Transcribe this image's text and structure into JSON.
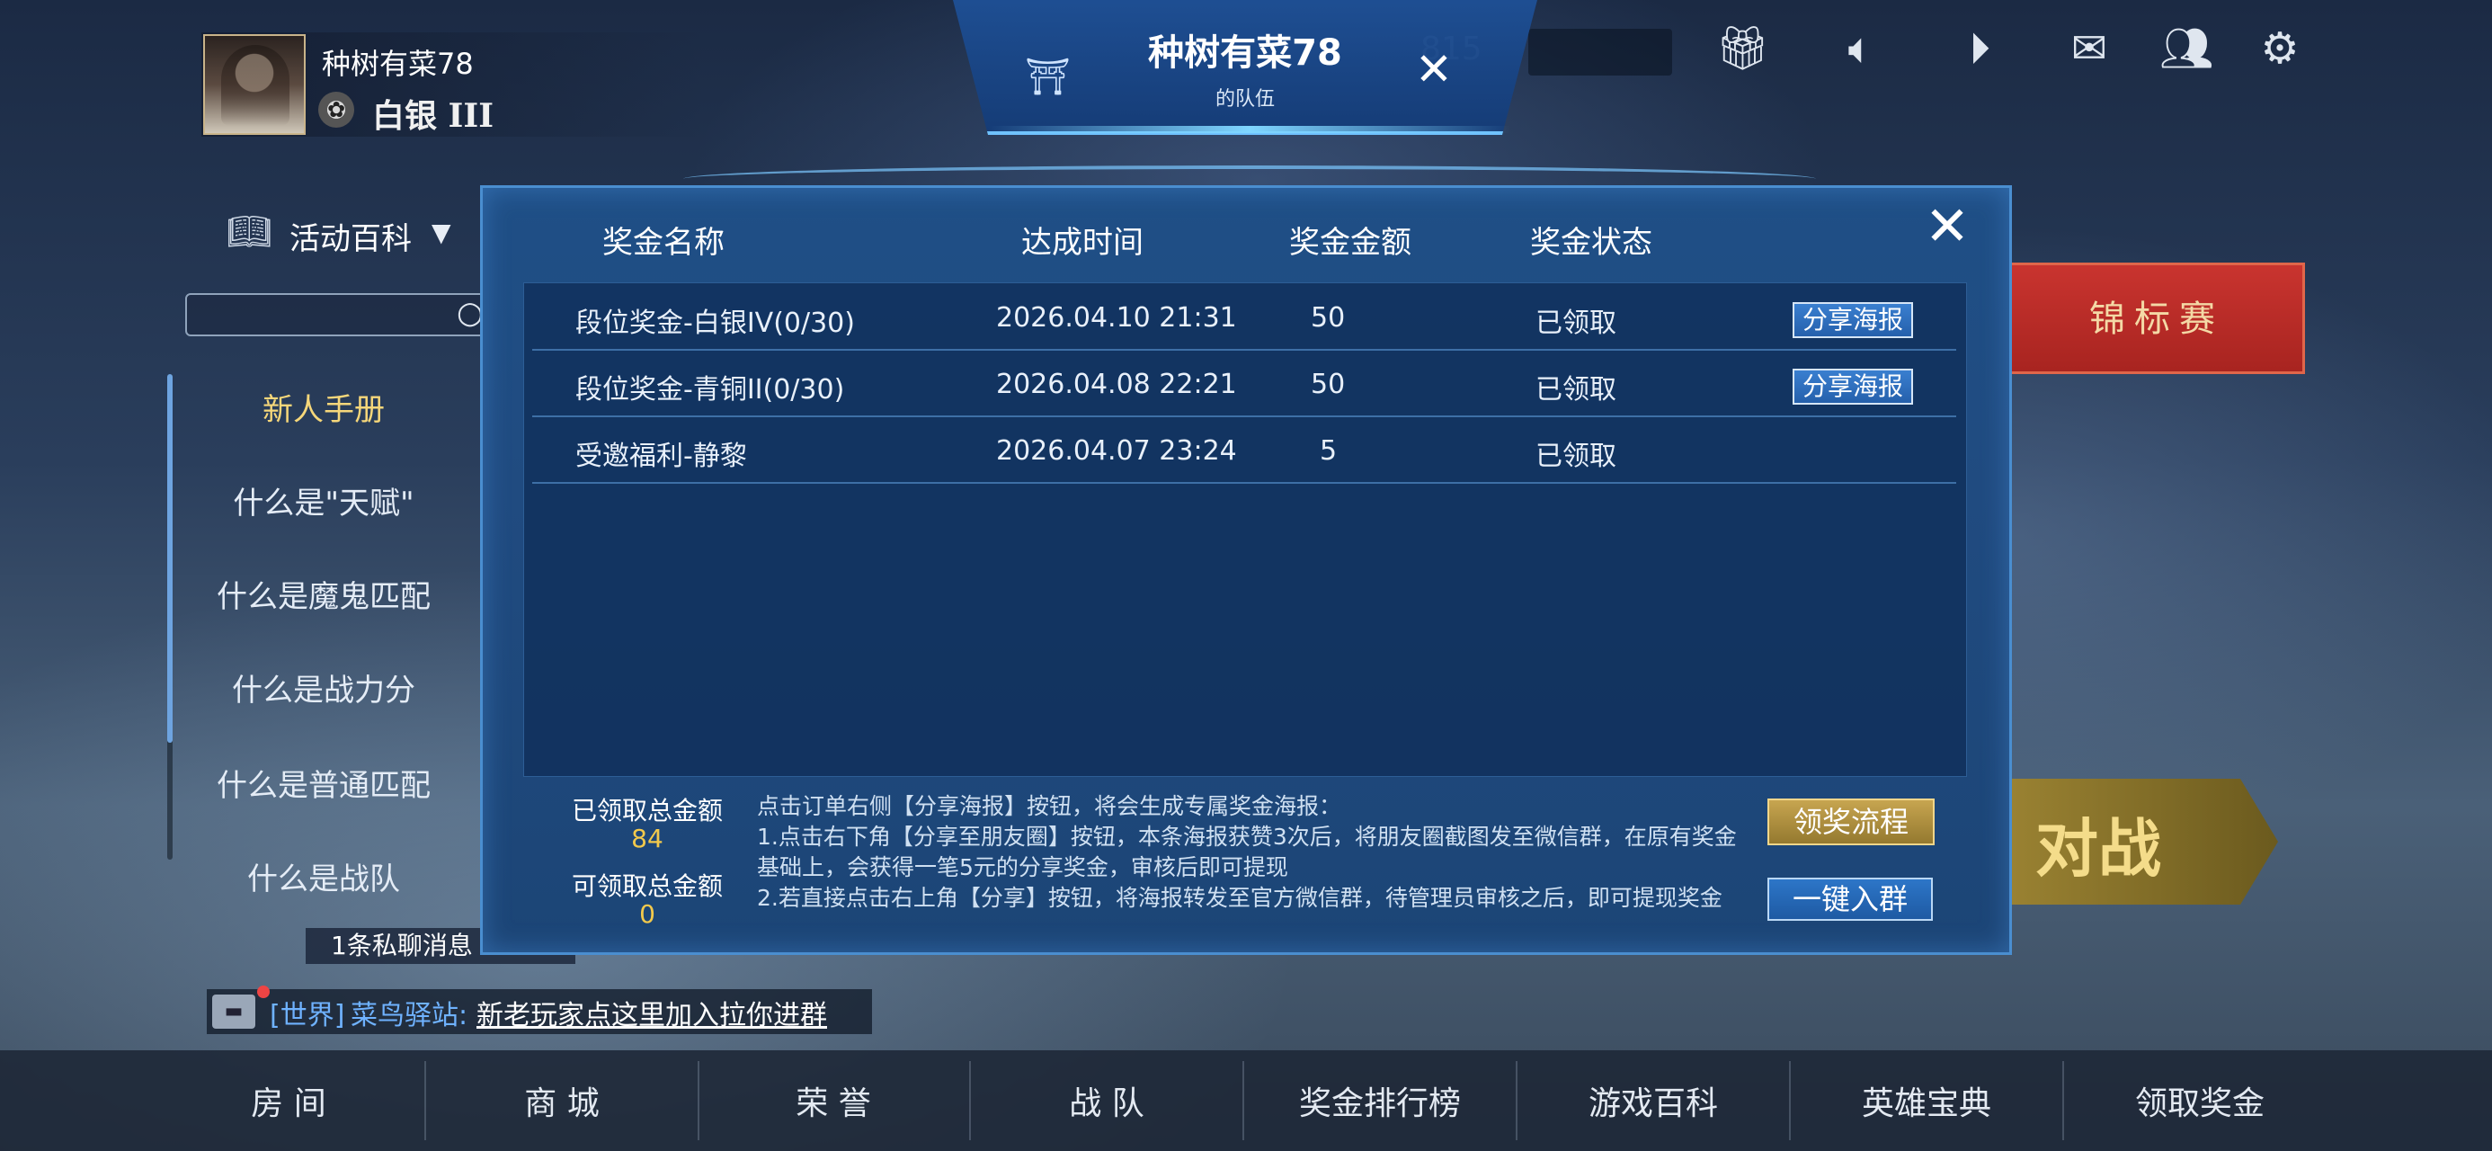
{
  "profile": {
    "username": "种树有菜78",
    "rank": "白银 III"
  },
  "team": {
    "name": "种树有菜78",
    "subtitle": "的队伍",
    "coin_value": "815"
  },
  "top_icons": [
    "gift-icon",
    "speaker-icon",
    "play-icon",
    "mail-icon",
    "friends-icon",
    "gear-icon"
  ],
  "left_panel": {
    "encyclopedia_label": "活动百科",
    "items": [
      {
        "label": "新人手册",
        "active": true
      },
      {
        "label": "什么是\"天赋\"",
        "active": false
      },
      {
        "label": "什么是魔鬼匹配",
        "active": false
      },
      {
        "label": "什么是战力分",
        "active": false
      },
      {
        "label": "什么是普通匹配",
        "active": false
      },
      {
        "label": "什么是战队",
        "active": false
      }
    ]
  },
  "private_message": "1条私聊消息",
  "world_chat": {
    "channel": "[世界]",
    "sender": "菜鸟驿站:",
    "message": "新老玩家点这里加入拉你进群"
  },
  "background_buttons": {
    "tournament": "锦标赛",
    "battle": "对战"
  },
  "modal": {
    "columns": [
      "奖金名称",
      "达成时间",
      "奖金金额",
      "奖金状态"
    ],
    "rows": [
      {
        "name": "段位奖金-白银IV(0/30)",
        "time": "2026.04.10 21:31",
        "amount": "50",
        "status": "已领取",
        "share": "分享海报"
      },
      {
        "name": "段位奖金-青铜II(0/30)",
        "time": "2026.04.08 22:21",
        "amount": "50",
        "status": "已领取",
        "share": "分享海报"
      },
      {
        "name": "受邀福利-静黎",
        "time": "2026.04.07 23:24",
        "amount": "5",
        "status": "已领取",
        "share": ""
      }
    ],
    "claimed_total_label": "已领取总金额",
    "claimed_total_value": "84",
    "available_total_label": "可领取总金额",
    "available_total_value": "0",
    "notice": [
      "点击订单右侧【分享海报】按钮，将会生成专属奖金海报：",
      "1.点击右下角【分享至朋友圈】按钮，本条海报获赞3次后，将朋友圈截图发至微信群，在原有奖金基础上，会获得一笔5元的分享奖金，审核后即可提现",
      "2.若直接点击右上角【分享】按钮，将海报转发至官方微信群，待管理员审核之后，即可提现奖金"
    ],
    "flow_button": "领奖流程",
    "group_button": "一键入群"
  },
  "bottom_nav": [
    "房 间",
    "商 城",
    "荣 誉",
    "战 队",
    "奖金排行榜",
    "游戏百科",
    "英雄宝典",
    "领取奖金"
  ],
  "colors": {
    "modal_bg": "#204b80",
    "gold": "#f2c94c",
    "accent_blue": "#6fb2ff",
    "tournament_red": "#b82a25"
  }
}
